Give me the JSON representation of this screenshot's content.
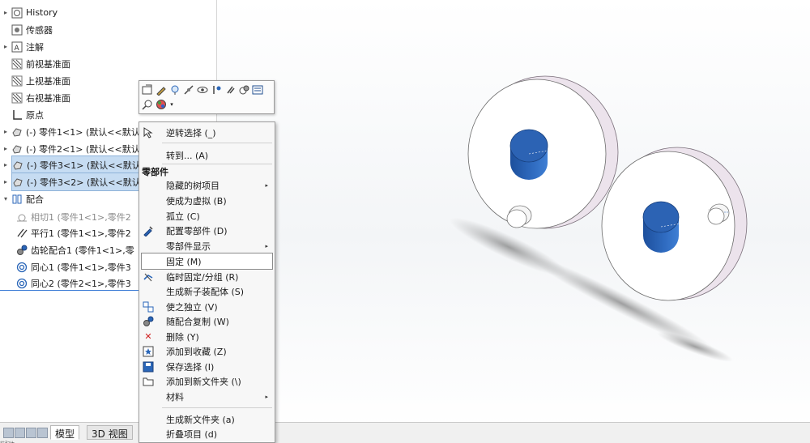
{
  "tree": {
    "items": [
      {
        "label": "History"
      },
      {
        "label": "传感器"
      },
      {
        "label": "注解"
      },
      {
        "label": "前视基准面"
      },
      {
        "label": "上视基准面"
      },
      {
        "label": "右视基准面"
      },
      {
        "label": "原点"
      },
      {
        "label": "(-) 零件1<1> (默认<<默认"
      },
      {
        "label": "(-) 零件2<1> (默认<<默认"
      },
      {
        "label": "(-) 零件3<1> (默认<<默认"
      },
      {
        "label": "(-) 零件3<2> (默认<<默认"
      },
      {
        "label": "配合"
      },
      {
        "label": "相切1 (零件1<1>,零件2"
      },
      {
        "label": "平行1 (零件1<1>,零件2"
      },
      {
        "label": "齿轮配合1 (零件1<1>,零"
      },
      {
        "label": "同心1 (零件1<1>,零件3"
      },
      {
        "label": "同心2 (零件2<1>,零件3"
      }
    ]
  },
  "context_menu": {
    "items": [
      {
        "label": "逆转选择 (_)"
      },
      {
        "label": "转到... (A)"
      },
      {
        "label": "隐藏的树项目"
      },
      {
        "label": "使成为虚拟 (B)"
      },
      {
        "label": "孤立 (C)"
      },
      {
        "label": "配置零部件 (D)"
      },
      {
        "label": "零部件显示"
      },
      {
        "label": "固定 (M)"
      },
      {
        "label": "临时固定/分组 (R)"
      },
      {
        "label": "生成新子装配体 (S)"
      },
      {
        "label": "使之独立 (V)"
      },
      {
        "label": "随配合复制 (W)"
      },
      {
        "label": "删除 (Y)"
      },
      {
        "label": "添加到收藏 (Z)"
      },
      {
        "label": "保存选择 (I)"
      },
      {
        "label": "添加到新文件夹 (\\)"
      },
      {
        "label": "材料"
      },
      {
        "label": "生成新文件夹 (a)"
      },
      {
        "label": "折叠项目 (d)"
      }
    ],
    "section_header": "零部件",
    "submenu_glyph": "▸"
  },
  "bottom_tabs": {
    "model": "模型",
    "view3d": "3D 视图"
  },
  "status": {
    "partial_text": "装配体"
  },
  "colors": {
    "selection": "#c6dcf2",
    "gear_face": "#ffffff",
    "gear_rim": "#ece3ec",
    "hub_blue": "#2f6bc0",
    "pin": "#f4f4f4"
  }
}
